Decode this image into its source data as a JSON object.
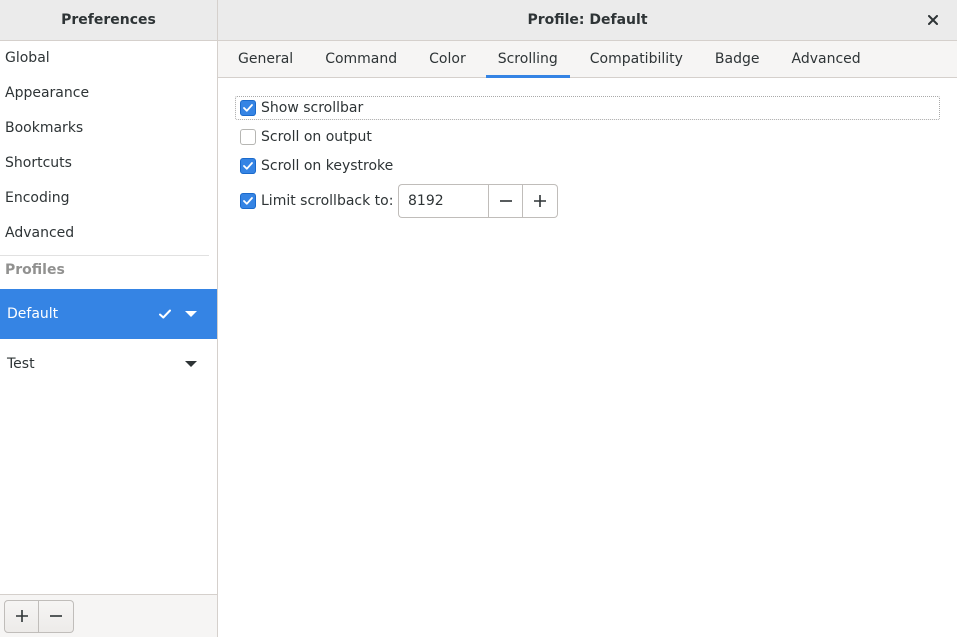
{
  "sidebar": {
    "title": "Preferences",
    "items": [
      {
        "label": "Global"
      },
      {
        "label": "Appearance"
      },
      {
        "label": "Bookmarks"
      },
      {
        "label": "Shortcuts"
      },
      {
        "label": "Encoding"
      },
      {
        "label": "Advanced"
      }
    ],
    "profiles_label": "Profiles",
    "profiles": [
      {
        "label": "Default",
        "selected": true,
        "is_default": true
      },
      {
        "label": "Test",
        "selected": false,
        "is_default": false
      }
    ],
    "footer": {
      "add_label": "+",
      "remove_label": "−"
    }
  },
  "main": {
    "title": "Profile: Default",
    "close_icon": "close-icon",
    "tabs": [
      {
        "label": "General"
      },
      {
        "label": "Command"
      },
      {
        "label": "Color"
      },
      {
        "label": "Scrolling",
        "active": true
      },
      {
        "label": "Compatibility"
      },
      {
        "label": "Badge"
      },
      {
        "label": "Advanced"
      }
    ],
    "options": {
      "show_scrollbar": {
        "label": "Show scrollbar",
        "checked": true
      },
      "scroll_on_output": {
        "label": "Scroll on output",
        "checked": false
      },
      "scroll_on_keystroke": {
        "label": "Scroll on keystroke",
        "checked": true
      },
      "limit_scrollback": {
        "label": "Limit scrollback to:",
        "checked": true,
        "value": "8192"
      }
    }
  },
  "colors": {
    "accent": "#3584e4",
    "header_bg": "#ebebeb"
  }
}
